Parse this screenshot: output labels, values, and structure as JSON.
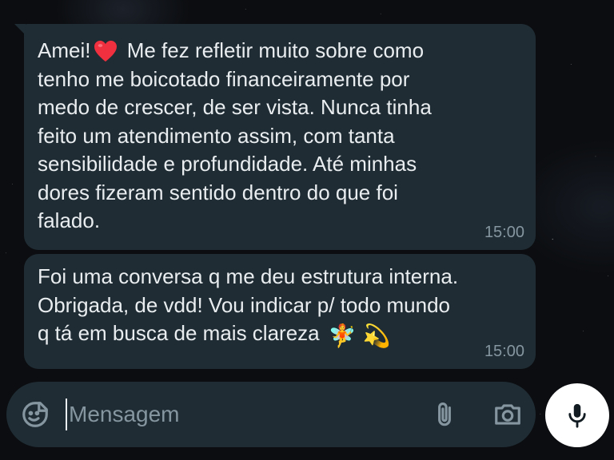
{
  "messages": [
    {
      "text_before_emoji": "Amei!",
      "emoji": "red-heart",
      "text_after_emoji": " Me fez refletir muito sobre como\ntenho me boicotado financeiramente por\nmedo de crescer, de ser vista. Nunca tinha\nfeito um atendimento assim, com tanta\nsensibilidade e profundidade. Até minhas\ndores fizeram sentido dentro do que foi\nfalado.",
      "time": "15:00"
    },
    {
      "text": "Foi uma conversa q me deu estrutura interna.\nObrigada, de vdd! Vou indicar p/ todo mundo\nq tá em busca de mais clareza",
      "emojis": [
        "🧚",
        "💫"
      ],
      "time": "15:00"
    }
  ],
  "composer": {
    "placeholder": "Mensagem"
  },
  "icons": {
    "emoji": "sticker-smiley-icon",
    "attach": "paperclip-icon",
    "camera": "camera-icon",
    "mic": "microphone-icon"
  },
  "colors": {
    "bubble": "#1f2c34",
    "text": "#e9edef",
    "meta": "#8696a0",
    "mic_button": "#ffffff"
  }
}
